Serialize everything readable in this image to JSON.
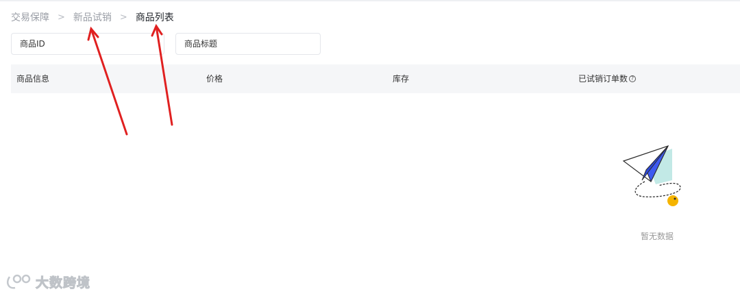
{
  "breadcrumb": {
    "items": [
      {
        "label": "交易保障"
      },
      {
        "label": "新品试销"
      },
      {
        "label": "商品列表"
      }
    ],
    "separator": ">"
  },
  "filters": {
    "product_id_placeholder": "商品ID",
    "product_title_placeholder": "商品标题"
  },
  "table": {
    "columns": [
      "商品信息",
      "价格",
      "库存",
      "已试销订单数"
    ],
    "help_icon": "question-circle-icon"
  },
  "empty_state": {
    "text": "暂无数据",
    "icon": "paper-plane-icon"
  },
  "annotations": {
    "arrow_color": "#e02020"
  },
  "watermark": {
    "text": "大数跨境"
  },
  "colors": {
    "plane_blue": "#3d5af1",
    "plane_shadow": "#a8e0dc",
    "dot_yellow": "#f5b400"
  }
}
